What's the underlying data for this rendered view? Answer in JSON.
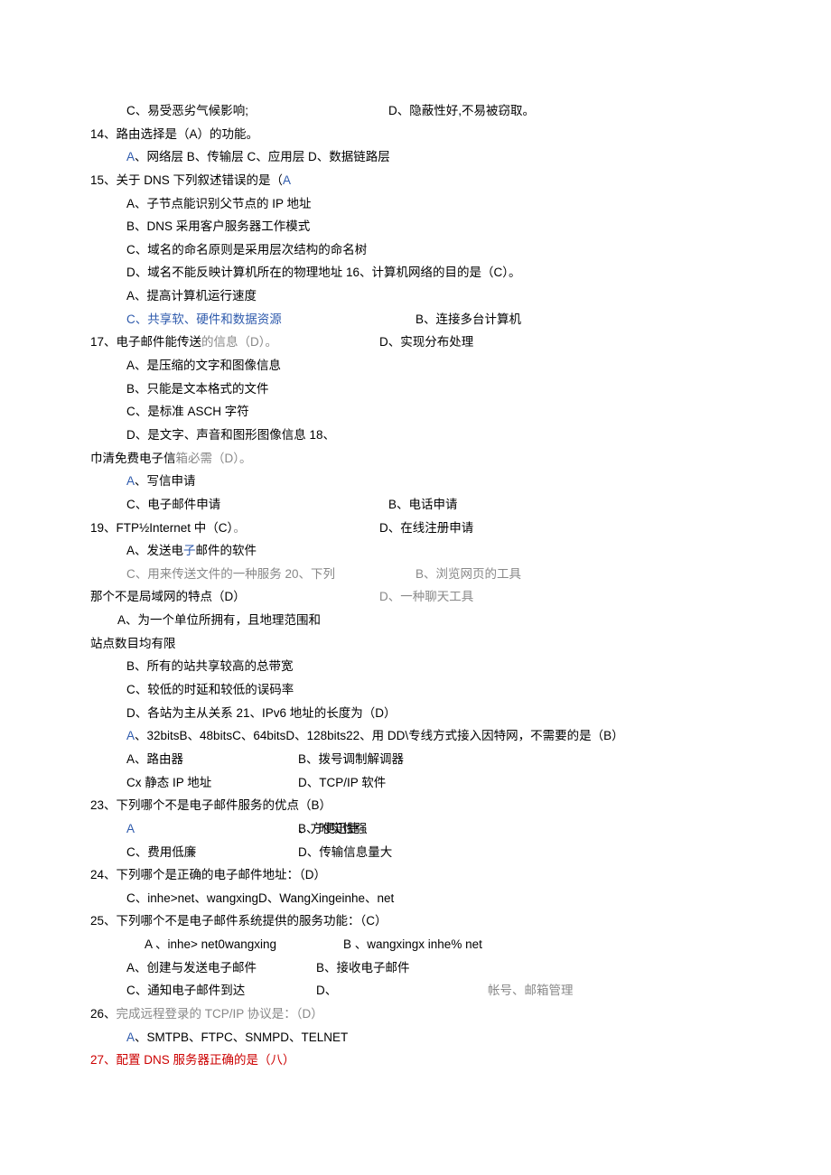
{
  "r1_c": "C、易受恶劣气候影响;",
  "r1_d": "D、隐蔽性好,不易被窃取。",
  "q14": "14、路由选择是（A）的功能。",
  "q14a": "A、网络层 B、传输层 C、应用层 D、数据链路层",
  "q15": "15、关于 DNS 下列叙述错误的是（A",
  "q15a": "A、子节点能识别父节点的 IP 地址",
  "q15b": "B、DNS 采用客户服务器工作模式",
  "q15c": "C、域名的命名原则是采用层次结构的命名树",
  "q15d": "D、域名不能反映计算机所在的物理地址 16、计算机网络的目的是（C）。",
  "q16a": "A、提高计算机运行速度",
  "q16c": "C、共享软、硬件和数据资源",
  "q16b": "B、连接多台计算机",
  "q17": "17、电子邮件能传送",
  "q17s": "的信息（D）。",
  "q16d": "D、实现分布处理",
  "q17a": "A、是压缩的文字和图像信息",
  "q17b": "B、只能是文本格式的文件",
  "q17c": "C、是标准 ASCH 字符",
  "q17d": "D、是文字、声音和图形图像信息 18、",
  "q18": "巾清免费电子信",
  "q18s": "箱必需（D）。",
  "q18a": "A、写信申请",
  "q18c": "C、电子邮件申请",
  "q18b": "B、电话申请",
  "q19": "19、FTP½Internet 中（C）。",
  "q18d": "D、在线注册申请",
  "q19a": "A、发送电",
  "q19as": "子邮件的软件",
  "q19cl": "C、用来传送文件的一种服务 20、下列",
  "q19b": "B、浏览网页的工具",
  "q20": "那个不是局域网的特点（D）",
  "q19d": "D、一种聊天工具",
  "q20a1": "A、为一个单位所拥有，且地理范围和",
  "q20a2": "站点数目均有限",
  "q20b": "B、所有的站共享较高的总带宽",
  "q20c": "C、较低的时延和较低的误码率",
  "q20d": "D、各站为主从关系 21、IPv6 地址的长度为（D）",
  "q21a": "A、32bitsB、48bitsC、64bitsD、128bits22、用 DD\\专线方式接入因特网，不需要的是（B）",
  "q22a": "A、路由器",
  "q22b": "B、拨号调制解调器",
  "q22c": "Cx 静态 IP 地址",
  "q22d": "D、TCP/IP 软件",
  "q23": "23、下列哪个不是电子邮件服务的优点（B）",
  "q23a": "A、方便迅捷",
  "q23b": "B、时实性强",
  "q23c": "C、费用低廉",
  "q23d": "D、传输信息量大",
  "q24": "24、下列哪个是正确的电子邮件地址：（D）",
  "q24c": "C、inhe>net、wangxingD、WangXingeinhe、net",
  "q25": "25、下列哪个不是电子邮件系统提供的服务功能：（C）",
  "q25ab": "A 、inhe> net0wangxing",
  "q25ab2": "B 、wangxingx inhe% net",
  "q25a": "A、创建与发送电子邮件",
  "q25b": "B、接收电子邮件",
  "q25c": "C、通知电子邮件到达",
  "q25d1": "D、",
  "q25d2": "帐号、邮箱管理",
  "q26": "26、",
  "q26s": "完成远程登录的 TCP/IP 协议是：（D）",
  "q26a": "A、SMTPB、FTPC、SNMPD、TELNET",
  "q27": "27、配置 DNS 服务器正确的是（八）"
}
